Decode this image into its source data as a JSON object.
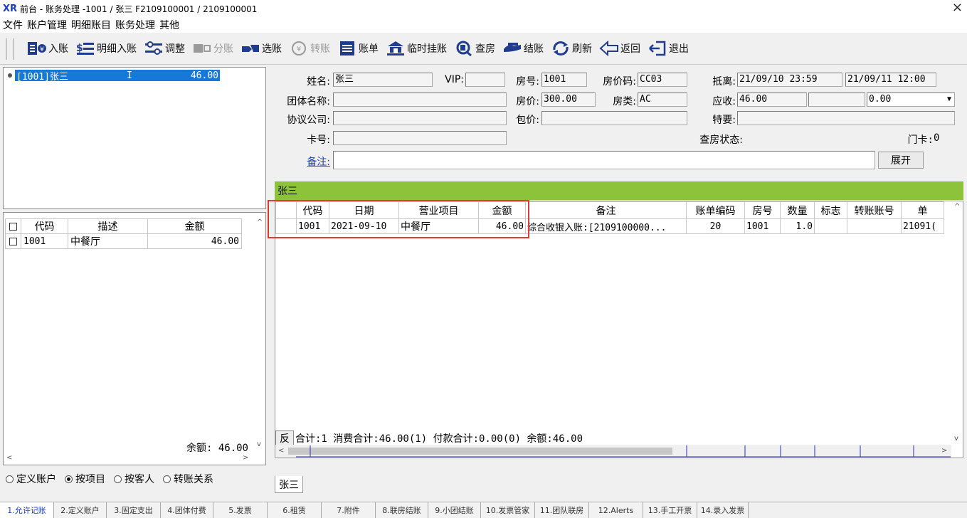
{
  "window": {
    "title": "前台 - 账务处理 -1001 / 张三 F2109100001 / 2109100001",
    "close_glyph": "×"
  },
  "menu": [
    "文件",
    "账户管理",
    "明细账目",
    "账务处理",
    "其他"
  ],
  "toolbar": [
    {
      "label": "入账",
      "icon": "post-entry-icon",
      "enabled": true
    },
    {
      "label": "明细入账",
      "icon": "detail-entry-icon",
      "enabled": true
    },
    {
      "label": "调整",
      "icon": "adjust-icon",
      "enabled": true
    },
    {
      "label": "分账",
      "icon": "split-bill-icon",
      "enabled": false
    },
    {
      "label": "选账",
      "icon": "select-bill-icon",
      "enabled": true
    },
    {
      "label": "转账",
      "icon": "transfer-icon",
      "enabled": false
    },
    {
      "label": "账单",
      "icon": "bill-icon",
      "enabled": true
    },
    {
      "label": "临时挂账",
      "icon": "temp-charge-icon",
      "enabled": true
    },
    {
      "label": "查房",
      "icon": "check-room-icon",
      "enabled": true
    },
    {
      "label": "结账",
      "icon": "checkout-icon",
      "enabled": true
    },
    {
      "label": "刷新",
      "icon": "refresh-icon",
      "enabled": true
    },
    {
      "label": "返回",
      "icon": "back-icon",
      "enabled": true
    },
    {
      "label": "退出",
      "icon": "exit-icon",
      "enabled": true
    }
  ],
  "account_tree": {
    "selected": {
      "code": "[1001]张三",
      "flag": "I",
      "amount": "46.00"
    }
  },
  "item_list": {
    "headers": {
      "code": "代码",
      "desc": "描述",
      "amount": "金额"
    },
    "rows": [
      {
        "code": "1001",
        "desc": "中餐厅",
        "amount": "46.00"
      }
    ],
    "balance": "余额: 46.00"
  },
  "view_mode": {
    "options": [
      "定义账户",
      "按项目",
      "按客人",
      "转账关系"
    ],
    "selected": "按项目"
  },
  "guest": {
    "name_label": "姓名:",
    "name": "张三",
    "vip_label": "VIP:",
    "vip": "",
    "room_label": "房号:",
    "room": "1001",
    "rate_code_label": "房价码:",
    "rate_code": "CC03",
    "arr_dep_label": "抵离:",
    "arrival": "21/09/10 23:59",
    "departure": "21/09/11 12:00",
    "group_label": "团体名称:",
    "group": "",
    "rate_label": "房价:",
    "rate": "300.00",
    "room_type_label": "房类:",
    "room_type": "AC",
    "receivable_label": "应收:",
    "receivable": "46.00",
    "receivable_2": "",
    "receivable_3": "0.00",
    "company_label": "协议公司:",
    "company": "",
    "package_label": "包价:",
    "package": "",
    "special_label": "特要:",
    "special": "",
    "card_label": "卡号:",
    "card": "",
    "check_status_label": "查房状态:",
    "door_card_label": "门卡:",
    "door_card": "0",
    "remark_label": "备注:",
    "remark": "",
    "expand_label": "展开"
  },
  "guest_strip": "张三",
  "bill_grid": {
    "headers": [
      "代码",
      "日期",
      "营业项目",
      "金额",
      "备注",
      "账单编码",
      "房号",
      "数量",
      "标志",
      "转账账号",
      "单"
    ],
    "rows": [
      {
        "code": "1001",
        "date": "2021-09-10",
        "item": "中餐厅",
        "amount": "46.00",
        "remark": "综合收银入账:[2109100000...",
        "bill_code": "20",
        "room": "1001",
        "qty": "1.0",
        "flag": "",
        "transfer": "",
        "unit": "21091("
      }
    ],
    "summary_button": "反",
    "summary": "合计:1  消费合计:46.00(1)  付款合计:0.00(0)  余额:46.00"
  },
  "bottom_tab": "张三",
  "function_keys": [
    "1.允许记账",
    "2.定义账户",
    "3.固定支出",
    "4.团体付费",
    "5.发票",
    "6.租赁",
    "7.附件",
    "8.联房结账",
    "9.小团结账",
    "10.发票管家",
    "11.团队联房",
    "12.Alerts",
    "13.手工开票",
    "14.录入发票"
  ],
  "colors": {
    "selection": "#1779d7",
    "guest_strip": "#8dc33a",
    "highlight_box": "#e43a34",
    "link": "#1a3fd0"
  }
}
